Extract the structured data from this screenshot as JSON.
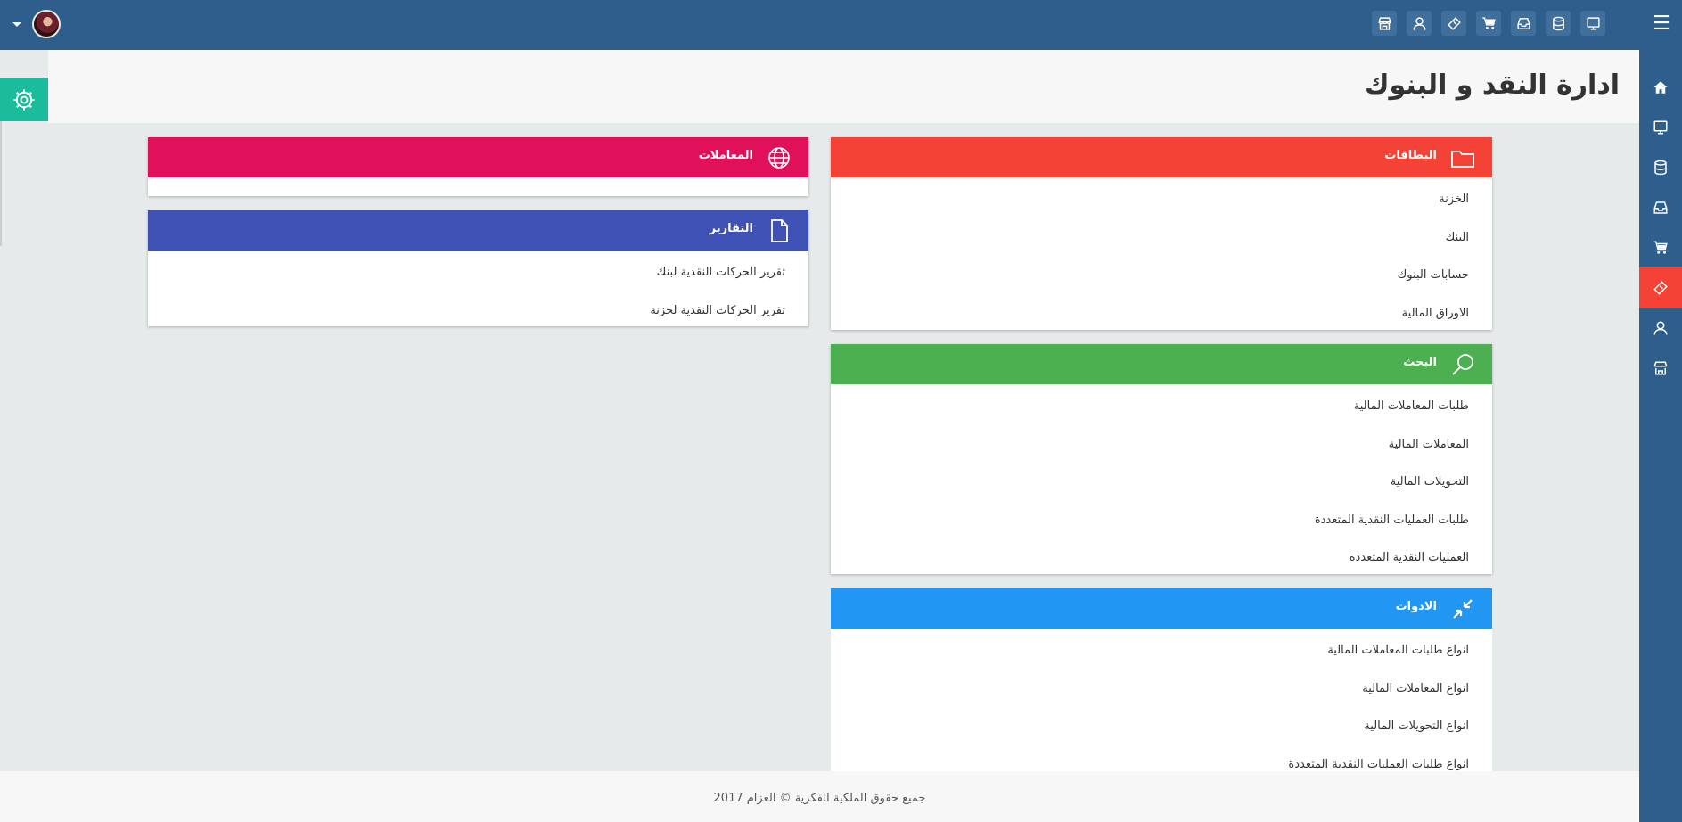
{
  "header": {
    "top_icons": [
      "monitor-icon",
      "database-icon",
      "inbox-icon",
      "cart-icon",
      "ticket-icon",
      "user-icon",
      "store-icon"
    ]
  },
  "sidebar": {
    "items": [
      "home-icon",
      "monitor-icon",
      "database-icon",
      "inbox-icon",
      "cart-icon",
      "ticket-icon",
      "user-icon",
      "store-icon"
    ],
    "active": "ticket-icon"
  },
  "page": {
    "title": "ادارة النقد و البنوك"
  },
  "panels": {
    "cards": {
      "title": "البطاقات",
      "color": "#f44336",
      "icon": "folder-icon",
      "items": [
        "الخزنة",
        "البنك",
        "حسابات البنوك",
        "الاوراق المالية"
      ]
    },
    "search": {
      "title": "البحث",
      "color": "#4caf50",
      "icon": "search-icon",
      "items": [
        "طلبات المعاملات المالية",
        "المعاملات المالية",
        "التحويلات المالية",
        "طلبات العمليات النقدية المتعددة",
        "العمليات النقدية المتعددة"
      ]
    },
    "tools": {
      "title": "الادوات",
      "color": "#2196f3",
      "icon": "compress-icon",
      "items": [
        "انواع طلبات المعاملات المالية",
        "انواع المعاملات المالية",
        "انواع التحويلات المالية",
        "انواع طلبات العمليات النقدية المتعددة"
      ]
    },
    "transactions": {
      "title": "المعاملات",
      "color": "#e0115a",
      "icon": "globe-icon",
      "items": []
    },
    "reports": {
      "title": "التقارير",
      "color": "#3f51b5",
      "icon": "file-icon",
      "items": [
        "تقرير الحركات النقدية لبنك",
        "تقرير الحركات النقدية لخزنة"
      ]
    }
  },
  "footer": {
    "copyright": "جميع حقوق الملكية الفكرية © العزام 2017"
  }
}
